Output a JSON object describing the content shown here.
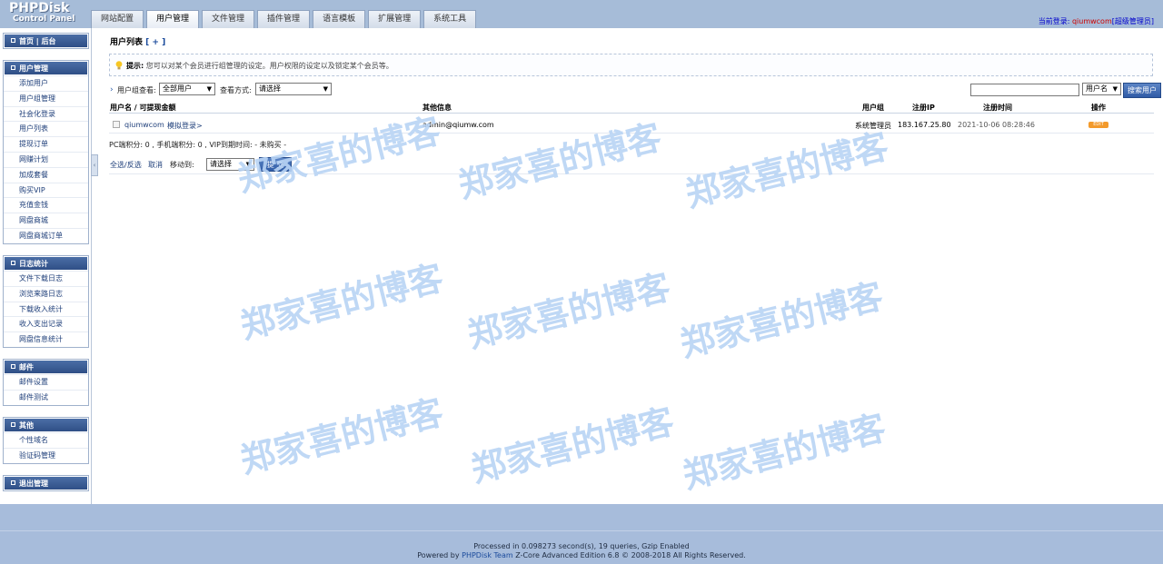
{
  "logo": {
    "line1": "PHPDisk",
    "line2": "Control Panel"
  },
  "tabs": [
    "网站配置",
    "用户管理",
    "文件管理",
    "插件管理",
    "语言模板",
    "扩展管理",
    "系统工具"
  ],
  "active_tab": "用户管理",
  "login": {
    "prefix": "当前登录:",
    "user": "qiumwcom",
    "role": "[超级管理员]"
  },
  "sidebar": {
    "home": "首页 | 后台",
    "sections": [
      {
        "title": "用户管理",
        "items": [
          "添加用户",
          "用户组管理",
          "社会化登录",
          "用户列表",
          "提现订单",
          "网赚计划",
          "加成套餐",
          "购买VIP",
          "充值金钱",
          "网盘商城",
          "网盘商城订单"
        ]
      },
      {
        "title": "日志统计",
        "items": [
          "文件下载日志",
          "浏览来路日志",
          "下载收入统计",
          "收入支出记录",
          "网盘信息统计"
        ]
      },
      {
        "title": "邮件",
        "items": [
          "邮件设置",
          "邮件测试"
        ]
      },
      {
        "title": "其他",
        "items": [
          "个性域名",
          "验证码管理"
        ]
      }
    ],
    "logout": "退出管理"
  },
  "main": {
    "title": "用户列表",
    "title_add": "[ + ]",
    "tip_label": "提示:",
    "tip_text": "您可以对某个会员进行组管理的设定。用户权限的设定以及锁定某个会员等。",
    "filter": {
      "group_label": "用户组查看:",
      "group_value": "全部用户",
      "view_label": "查看方式:",
      "view_value": "请选择",
      "search_type": "用户名",
      "search_button": "搜索用户"
    },
    "columns": [
      "用户名 / 可提现金额",
      "其他信息",
      "用户组",
      "注册IP",
      "注册时间",
      "操作"
    ],
    "rows": [
      {
        "username": "qiumwcom",
        "login_as": "模拟登录>",
        "email": "admin@qiumw.com",
        "group": "系统管理员",
        "ip": "183.167.25.80",
        "time": "2021-10-06 08:28:46",
        "action": "EDIT"
      }
    ],
    "info_line": "PC端积分: 0 , 手机端积分: 0 , VIP到期时间: - 未购买 -",
    "bulk": {
      "select_all": "全选/反选",
      "cancel": "取消",
      "move_to": "移动到:",
      "move_value": "请选择",
      "submit": "提 交"
    }
  },
  "footer": {
    "line1": "Processed in 0.098273 second(s), 19 queries, Gzip Enabled",
    "powered_prefix": "Powered by",
    "team": "PHPDisk Team",
    "powered_suffix": "Z-Core Advanced Edition 6.8 © 2008-2018 All Rights Reserved."
  },
  "watermark": "郑家喜的博客",
  "colors": {
    "topbar": "#a6bcd8",
    "sidebar_head": "#2f4f86",
    "footer": "#a7bcdb",
    "watermark": "#b9d4f5"
  }
}
